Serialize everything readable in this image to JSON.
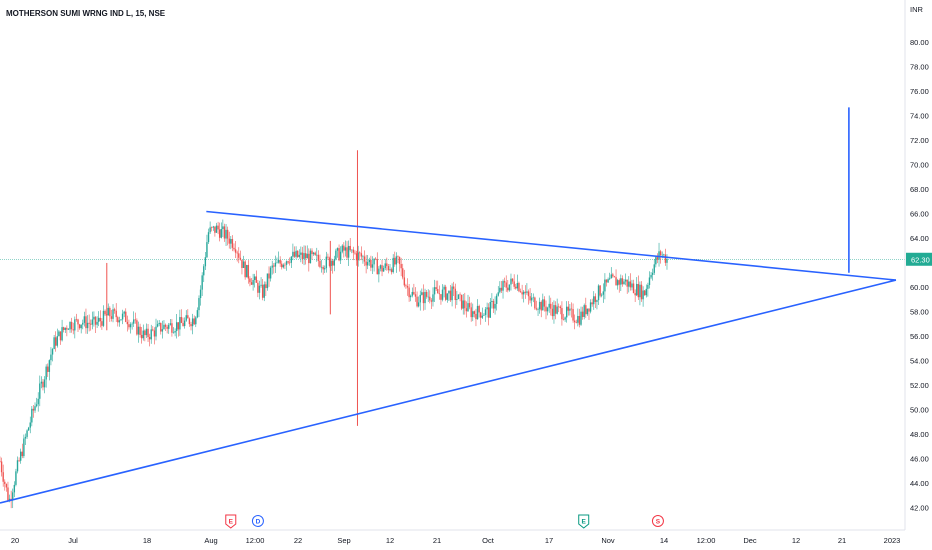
{
  "chart_data": {
    "type": "candlestick",
    "title": "MOTHERSON SUMI WRNG IND L, 15, NSE",
    "y_unit": "INR",
    "ylim": [
      41.5,
      82.0
    ],
    "y_ticks": [
      "42.00",
      "44.00",
      "46.00",
      "48.00",
      "50.00",
      "52.00",
      "54.00",
      "56.00",
      "58.00",
      "60.00",
      "62.00",
      "64.00",
      "66.00",
      "68.00",
      "70.00",
      "72.00",
      "74.00",
      "76.00",
      "78.00",
      "80.00"
    ],
    "x_ticks": [
      "20",
      "Jul",
      "18",
      "Aug",
      "12:00",
      "22",
      "Sep",
      "12",
      "21",
      "Oct",
      "17",
      "Nov",
      "14",
      "12:00",
      "Dec",
      "12",
      "21",
      "2023"
    ],
    "last_price": "62.30",
    "trendlines": [
      {
        "name": "upper",
        "from": {
          "t": 0.228,
          "price": 66.2
        },
        "to": {
          "t": 0.99,
          "price": 60.6
        }
      },
      {
        "name": "lower",
        "from": {
          "t": 0.0,
          "price": 42.4
        },
        "to": {
          "t": 0.99,
          "price": 60.6
        }
      },
      {
        "name": "target-line",
        "from": {
          "t": 0.938,
          "price": 61.2
        },
        "to": {
          "t": 0.938,
          "price": 74.7
        }
      }
    ],
    "price_path": [
      [
        0.0,
        45.8
      ],
      [
        0.01,
        42.5
      ],
      [
        0.02,
        45.5
      ],
      [
        0.035,
        49.5
      ],
      [
        0.05,
        53.0
      ],
      [
        0.06,
        55.5
      ],
      [
        0.075,
        57.0
      ],
      [
        0.09,
        57.2
      ],
      [
        0.105,
        57.0
      ],
      [
        0.12,
        57.8
      ],
      [
        0.14,
        57.5
      ],
      [
        0.16,
        56.0
      ],
      [
        0.18,
        56.8
      ],
      [
        0.2,
        57.0
      ],
      [
        0.215,
        57.5
      ],
      [
        0.222,
        60.0
      ],
      [
        0.23,
        64.5
      ],
      [
        0.24,
        64.8
      ],
      [
        0.25,
        64.2
      ],
      [
        0.26,
        63.5
      ],
      [
        0.27,
        61.5
      ],
      [
        0.28,
        60.5
      ],
      [
        0.29,
        59.5
      ],
      [
        0.3,
        61.5
      ],
      [
        0.32,
        62.5
      ],
      [
        0.34,
        62.5
      ],
      [
        0.36,
        62.0
      ],
      [
        0.38,
        63.0
      ],
      [
        0.4,
        62.5
      ],
      [
        0.42,
        61.5
      ],
      [
        0.44,
        62.0
      ],
      [
        0.45,
        60.0
      ],
      [
        0.46,
        59.0
      ],
      [
        0.48,
        59.5
      ],
      [
        0.5,
        59.5
      ],
      [
        0.52,
        58.0
      ],
      [
        0.54,
        58.0
      ],
      [
        0.555,
        60.0
      ],
      [
        0.57,
        60.5
      ],
      [
        0.585,
        59.0
      ],
      [
        0.6,
        58.5
      ],
      [
        0.62,
        58.0
      ],
      [
        0.64,
        57.5
      ],
      [
        0.65,
        58.5
      ],
      [
        0.66,
        59.5
      ],
      [
        0.675,
        60.5
      ],
      [
        0.69,
        60.5
      ],
      [
        0.7,
        60.0
      ],
      [
        0.712,
        59.5
      ],
      [
        0.72,
        61.5
      ],
      [
        0.73,
        62.8
      ],
      [
        0.737,
        62.3
      ]
    ],
    "spikes": [
      {
        "t": 0.118,
        "hi": 62.0,
        "lo": 56.5,
        "color": "#ef5350"
      },
      {
        "t": 0.365,
        "hi": 63.8,
        "lo": 57.8,
        "color": "#ef5350"
      },
      {
        "t": 0.395,
        "hi": 71.2,
        "lo": 48.7,
        "color": "#ef5350"
      }
    ],
    "events": [
      {
        "label": "E",
        "color": "#f23645",
        "t": 0.255
      },
      {
        "label": "D",
        "color": "#2962ff",
        "t": 0.285
      },
      {
        "label": "E",
        "color": "#089981",
        "t": 0.645
      },
      {
        "label": "S",
        "color": "#f23645",
        "t": 0.727
      }
    ],
    "colors": {
      "up": "#26a69a",
      "down": "#ef5350",
      "trend": "#2962ff",
      "price_tag": "#22ab94"
    },
    "grid": false
  }
}
